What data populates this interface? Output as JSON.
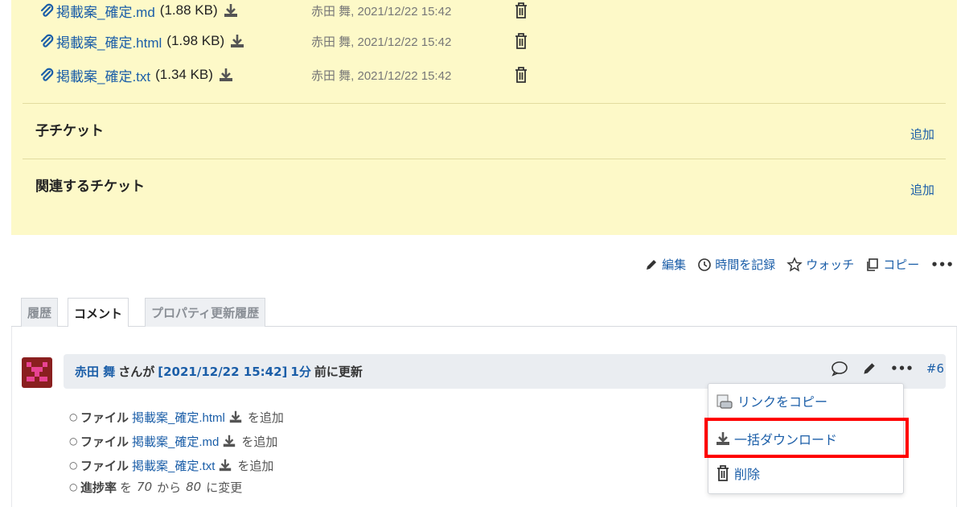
{
  "attachments": [
    {
      "name": "掲載案_確定.md",
      "size": "(1.88 KB)",
      "author": "赤田 舞, 2021/12/22 15:42"
    },
    {
      "name": "掲載案_確定.html",
      "size": "(1.98 KB)",
      "author": "赤田 舞, 2021/12/22 15:42"
    },
    {
      "name": "掲載案_確定.txt",
      "size": "(1.34 KB)",
      "author": "赤田 舞, 2021/12/22 15:42"
    }
  ],
  "subtasks": {
    "title": "子チケット",
    "add_label": "追加"
  },
  "relations": {
    "title": "関連するチケット",
    "add_label": "追加"
  },
  "contextual": {
    "edit": "編集",
    "log_time": "時間を記録",
    "watch": "ウォッチ",
    "copy": "コピー",
    "more": "•••"
  },
  "tabs": [
    {
      "label": "履歴",
      "active": false
    },
    {
      "label": "コメント",
      "active": true
    },
    {
      "label": "プロパティ更新履歴",
      "active": false
    }
  ],
  "journal": {
    "author": "赤田 舞",
    "text_by": "さんが",
    "timestamp": "[2021/12/22 15:42]",
    "ago": "1分",
    "text_updated": "前に更新",
    "number": "#6",
    "more": "•••",
    "details": [
      {
        "label": "ファイル",
        "file": "掲載案_確定.html",
        "suffix": "を追加"
      },
      {
        "label": "ファイル",
        "file": "掲載案_確定.md",
        "suffix": "を追加"
      },
      {
        "label": "ファイル",
        "file": "掲載案_確定.txt",
        "suffix": "を追加"
      }
    ],
    "progress": {
      "label": "進捗率",
      "from_word": "を",
      "from": "70",
      "mid": "から",
      "to": "80",
      "end": "に変更"
    }
  },
  "menu": {
    "copy_link": "リンクをコピー",
    "bulk_download": "一括ダウンロード",
    "delete": "削除"
  },
  "colors": {
    "link": "#1b5ea8",
    "issue_bg": "#fdf9c8",
    "highlight": "#ff0000"
  }
}
